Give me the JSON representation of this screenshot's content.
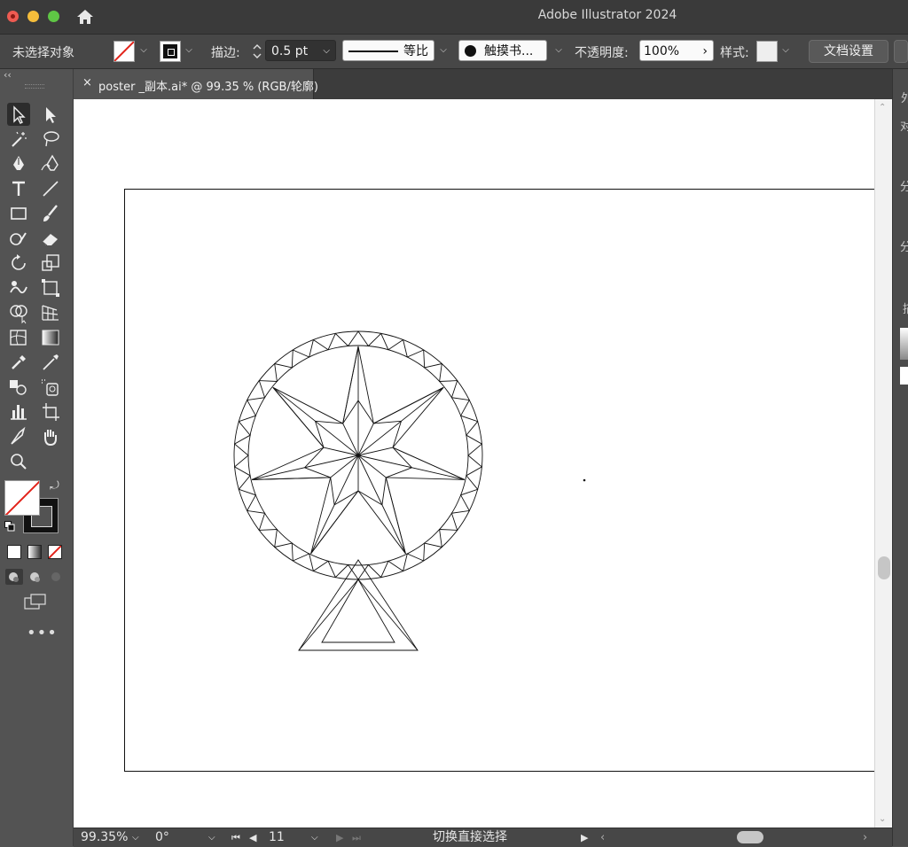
{
  "window": {
    "app_title": "Adobe Illustrator 2024"
  },
  "control_bar": {
    "selection_status": "未选择对象",
    "stroke_label": "描边:",
    "stroke_weight": "0.5 pt",
    "stroke_profile": "等比",
    "brush_name": "触摸书...",
    "opacity_label": "不透明度:",
    "opacity_value": "100%",
    "style_label": "样式:",
    "doc_setup_button": "文档设置"
  },
  "document_tab": {
    "close_glyph": "×",
    "title": "poster _副本.ai* @ 99.35 % (RGB/轮廓)"
  },
  "status_bar": {
    "zoom": "99.35%",
    "rotation": "0°",
    "artboard_number": "11",
    "current_tool": "切换直接选择"
  },
  "right_panel": {
    "glyphs": [
      "外",
      "对",
      "分",
      "分",
      "描"
    ]
  },
  "icons": [
    "home-icon",
    "selection-tool-icon",
    "direct-selection-tool-icon",
    "magic-wand-icon",
    "lasso-icon",
    "pen-icon",
    "curvature-icon",
    "type-icon",
    "line-icon",
    "rectangle-icon",
    "paintbrush-icon",
    "shaper-icon",
    "eraser-icon",
    "rotate-icon",
    "scale-icon",
    "warp-icon",
    "free-transform-icon",
    "shape-builder-icon",
    "perspective-grid-icon",
    "mesh-icon",
    "gradient-icon",
    "eyedropper-icon",
    "measure-icon",
    "blend-icon",
    "symbol-sprayer-icon",
    "column-graph-icon",
    "artboard-icon",
    "slice-icon",
    "hand-icon",
    "zoom-icon",
    "swap-icon",
    "more-tools-icon"
  ],
  "colors": {
    "ui_bg": "#535353",
    "control_bar_bg": "#474747",
    "title_bar_bg": "#3a3a3a",
    "canvas_bg": "#ffffff",
    "none_slash": "#e2231a"
  }
}
